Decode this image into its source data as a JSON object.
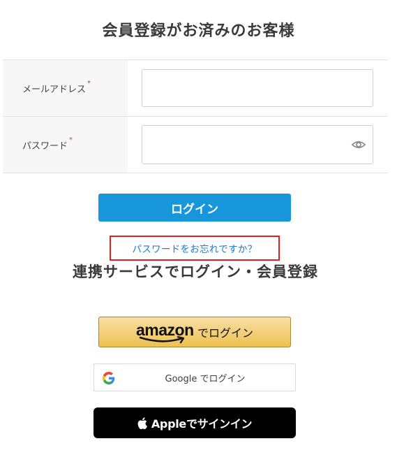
{
  "page": {
    "title": "会員登録がお済みのお客様",
    "social_title": "連携サービスでログイン・会員登録"
  },
  "form": {
    "email_label": "メールアドレス",
    "password_label": "パスワード",
    "required_mark": "*",
    "email_value": "",
    "password_value": "",
    "eye_icon": "eye-icon"
  },
  "actions": {
    "login_label": "ログイン",
    "forgot_password_label": "パスワードをお忘れですか？"
  },
  "social": {
    "amazon_logo_text": "amazon",
    "amazon_label": "でログイン",
    "google_label": "Google でログイン",
    "apple_label": "Appleでサインイン"
  },
  "colors": {
    "primary_button": "#1896dc",
    "link": "#1a7ec8",
    "highlight_border": "#e02020",
    "required": "#e03a3a"
  }
}
